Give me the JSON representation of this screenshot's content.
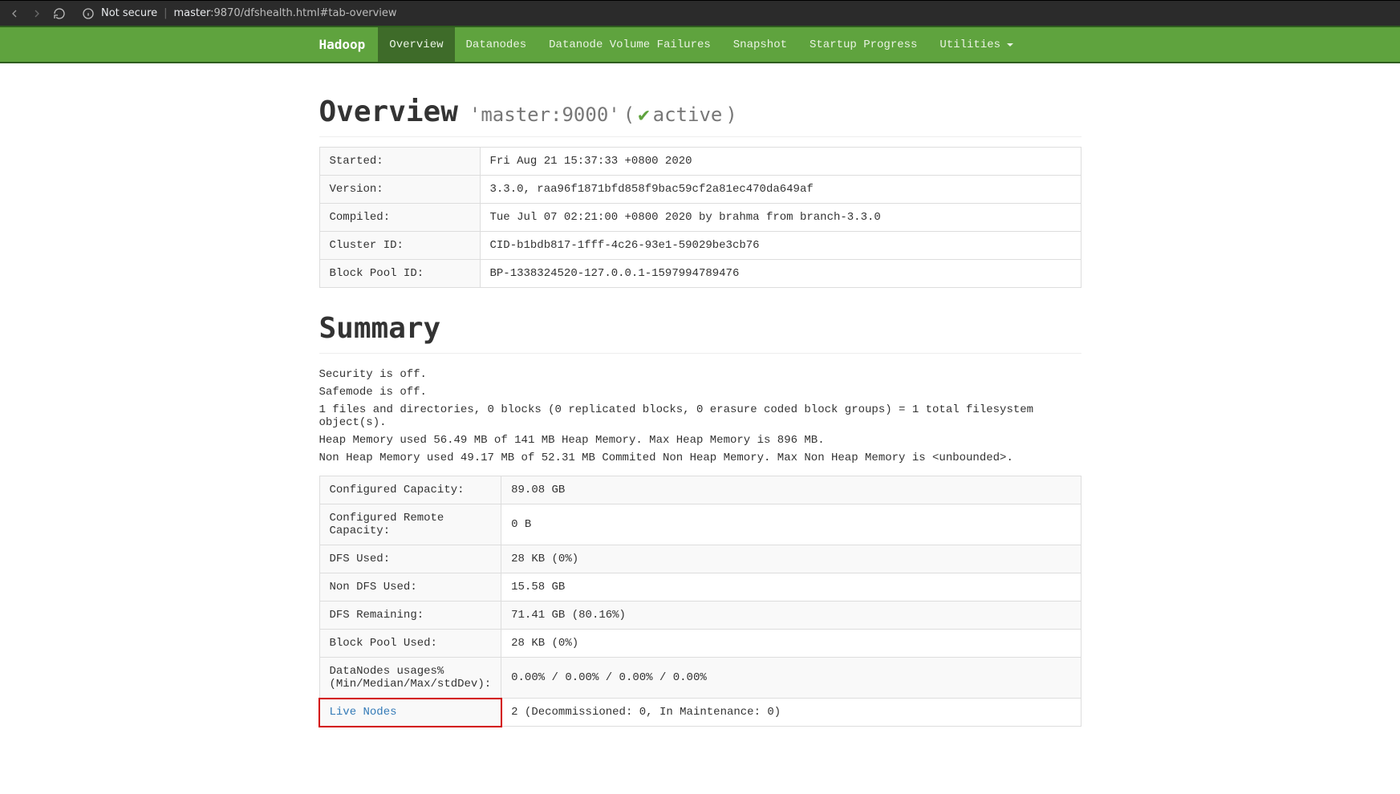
{
  "browser": {
    "not_secure_label": "Not secure",
    "url_host": "master",
    "url_rest": ":9870/dfshealth.html#tab-overview"
  },
  "nav": {
    "brand": "Hadoop",
    "items": [
      {
        "label": "Overview",
        "active": true
      },
      {
        "label": "Datanodes"
      },
      {
        "label": "Datanode Volume Failures"
      },
      {
        "label": "Snapshot"
      },
      {
        "label": "Startup Progress"
      },
      {
        "label": "Utilities",
        "dropdown": true
      }
    ]
  },
  "overview": {
    "title": "Overview",
    "subtitle_host": "'master:9000'",
    "subtitle_open": " (",
    "subtitle_status": "active",
    "subtitle_close": ")",
    "rows": [
      {
        "k": "Started:",
        "v": "Fri Aug 21 15:37:33 +0800 2020"
      },
      {
        "k": "Version:",
        "v": "3.3.0, raa96f1871bfd858f9bac59cf2a81ec470da649af"
      },
      {
        "k": "Compiled:",
        "v": "Tue Jul 07 02:21:00 +0800 2020 by brahma from branch-3.3.0"
      },
      {
        "k": "Cluster ID:",
        "v": "CID-b1bdb817-1fff-4c26-93e1-59029be3cb76"
      },
      {
        "k": "Block Pool ID:",
        "v": "BP-1338324520-127.0.0.1-1597994789476"
      }
    ]
  },
  "summary": {
    "title": "Summary",
    "lines": [
      "Security is off.",
      "Safemode is off.",
      "1 files and directories, 0 blocks (0 replicated blocks, 0 erasure coded block groups) = 1 total filesystem object(s).",
      "Heap Memory used 56.49 MB of 141 MB Heap Memory. Max Heap Memory is 896 MB.",
      "Non Heap Memory used 49.17 MB of 52.31 MB Commited Non Heap Memory. Max Non Heap Memory is <unbounded>."
    ],
    "rows": [
      {
        "k": "Configured Capacity:",
        "v": "89.08 GB"
      },
      {
        "k": "Configured Remote Capacity:",
        "v": "0 B"
      },
      {
        "k": "DFS Used:",
        "v": "28 KB (0%)"
      },
      {
        "k": "Non DFS Used:",
        "v": "15.58 GB"
      },
      {
        "k": "DFS Remaining:",
        "v": "71.41 GB (80.16%)"
      },
      {
        "k": "Block Pool Used:",
        "v": "28 KB (0%)"
      },
      {
        "k": "DataNodes usages% (Min/Median/Max/stdDev):",
        "v": "0.00% / 0.00% / 0.00% / 0.00%"
      },
      {
        "k": "Live Nodes",
        "v": "2 (Decommissioned: 0, In Maintenance: 0)",
        "link": true,
        "highlight": true
      }
    ]
  }
}
